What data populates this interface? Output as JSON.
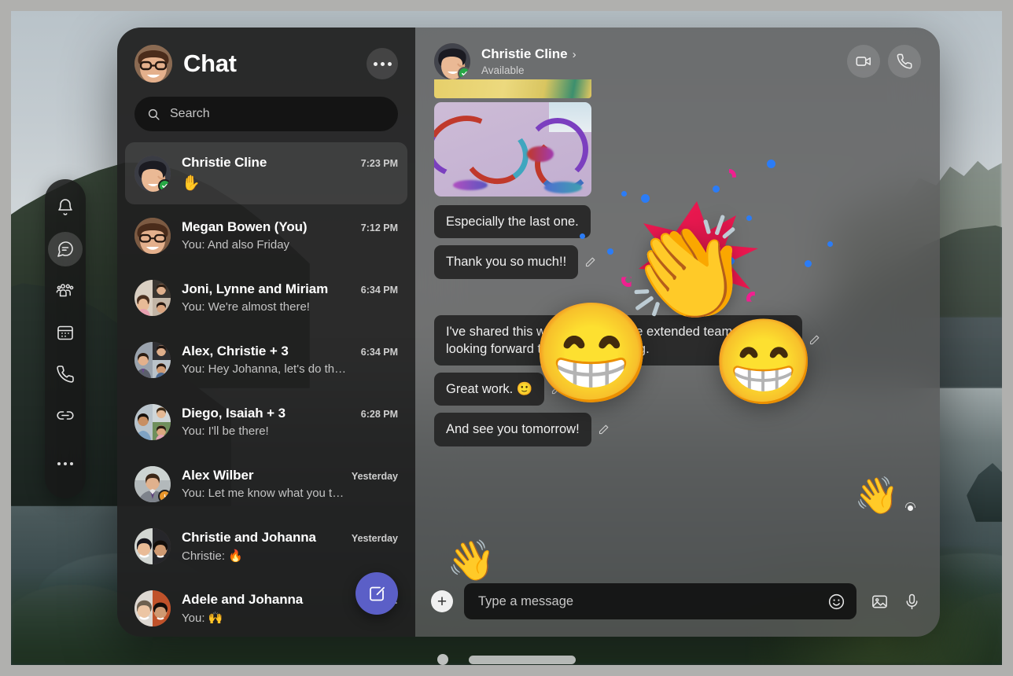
{
  "app": {
    "title": "Chat",
    "more_label": "More options"
  },
  "search": {
    "placeholder": "Search",
    "value": "",
    "icon": "search-icon"
  },
  "rail": {
    "items": [
      {
        "name": "activity",
        "icon": "bell-icon",
        "active": false
      },
      {
        "name": "chat",
        "icon": "chat-bubble-icon",
        "active": true
      },
      {
        "name": "teams",
        "icon": "people-icon",
        "active": false
      },
      {
        "name": "calendar",
        "icon": "calendar-icon",
        "active": false
      },
      {
        "name": "calls",
        "icon": "phone-icon",
        "active": false
      },
      {
        "name": "files",
        "icon": "link-icon",
        "active": false
      }
    ],
    "more_label": "More apps"
  },
  "chat_list": [
    {
      "name": "Christie Cline",
      "time": "7:23 PM",
      "preview": "✋",
      "preview_is_emoji": true,
      "selected": true,
      "presence": "available"
    },
    {
      "name": "Megan Bowen (You)",
      "time": "7:12 PM",
      "preview": "You: And also Friday",
      "preview_is_emoji": false,
      "selected": false,
      "presence": ""
    },
    {
      "name": "Joni, Lynne and Miriam",
      "time": "6:34 PM",
      "preview": "You: We're almost there!",
      "preview_is_emoji": false,
      "selected": false,
      "presence": ""
    },
    {
      "name": "Alex, Christie + 3",
      "time": "6:34 PM",
      "preview": "You: Hey Johanna, let's do th…",
      "preview_is_emoji": false,
      "selected": false,
      "presence": ""
    },
    {
      "name": "Diego, Isaiah + 3",
      "time": "6:28 PM",
      "preview": "You: I'll be there!",
      "preview_is_emoji": false,
      "selected": false,
      "presence": ""
    },
    {
      "name": "Alex Wilber",
      "time": "Yesterday",
      "preview": "You: Let me know what you t…",
      "preview_is_emoji": false,
      "selected": false,
      "presence": "away"
    },
    {
      "name": "Christie and Johanna",
      "time": "Yesterday",
      "preview": "Christie: 🔥",
      "preview_is_emoji": false,
      "selected": false,
      "presence": ""
    },
    {
      "name": "Adele and Johanna",
      "time": "Wedn…",
      "preview": "You: 🙌",
      "preview_is_emoji": false,
      "selected": false,
      "presence": ""
    }
  ],
  "compose_fab": {
    "label": "New chat",
    "icon": "compose-icon"
  },
  "conversation": {
    "contact_name": "Christie Cline",
    "chevron": "›",
    "status": "Available",
    "presence": "available",
    "actions": [
      {
        "name": "video-call",
        "icon": "video-camera-icon"
      },
      {
        "name": "audio-call",
        "icon": "phone-icon"
      }
    ],
    "messages": [
      {
        "text": "Especially the last one.",
        "has_pencil": false
      },
      {
        "text": "Thank you so much!!",
        "has_pencil": true
      },
      {
        "text": "I've shared this with the team. The extended team also looking forward to seeing this thing.",
        "has_pencil": true
      },
      {
        "text": "Great work. 🙂",
        "has_pencil": true
      },
      {
        "text": "And see you tomorrow!",
        "has_pencil": true
      }
    ],
    "reactions": [
      {
        "name": "clapping-hands-reaction",
        "emoji": "👏"
      },
      {
        "name": "laughing-reaction-large",
        "emoji": "😁"
      },
      {
        "name": "laughing-reaction-small",
        "emoji": "😁"
      },
      {
        "name": "waving-smiley-reaction-left",
        "emoji": "👋"
      },
      {
        "name": "waving-smiley-reaction-right",
        "emoji": "👋"
      }
    ]
  },
  "compose": {
    "placeholder": "Type a message",
    "value": "",
    "add_label": "+",
    "buttons": [
      {
        "name": "emoji",
        "icon": "smiley-icon"
      },
      {
        "name": "image",
        "icon": "picture-icon"
      },
      {
        "name": "voice",
        "icon": "microphone-icon"
      }
    ]
  },
  "window_controls": {
    "dot_label": "Window indicator",
    "bar_label": "Window resize handle"
  },
  "colors": {
    "accent": "#5b5fc7",
    "available": "#27a745",
    "away": "#e8952a",
    "panel": "#202020",
    "conversation_panel": "#585858"
  }
}
